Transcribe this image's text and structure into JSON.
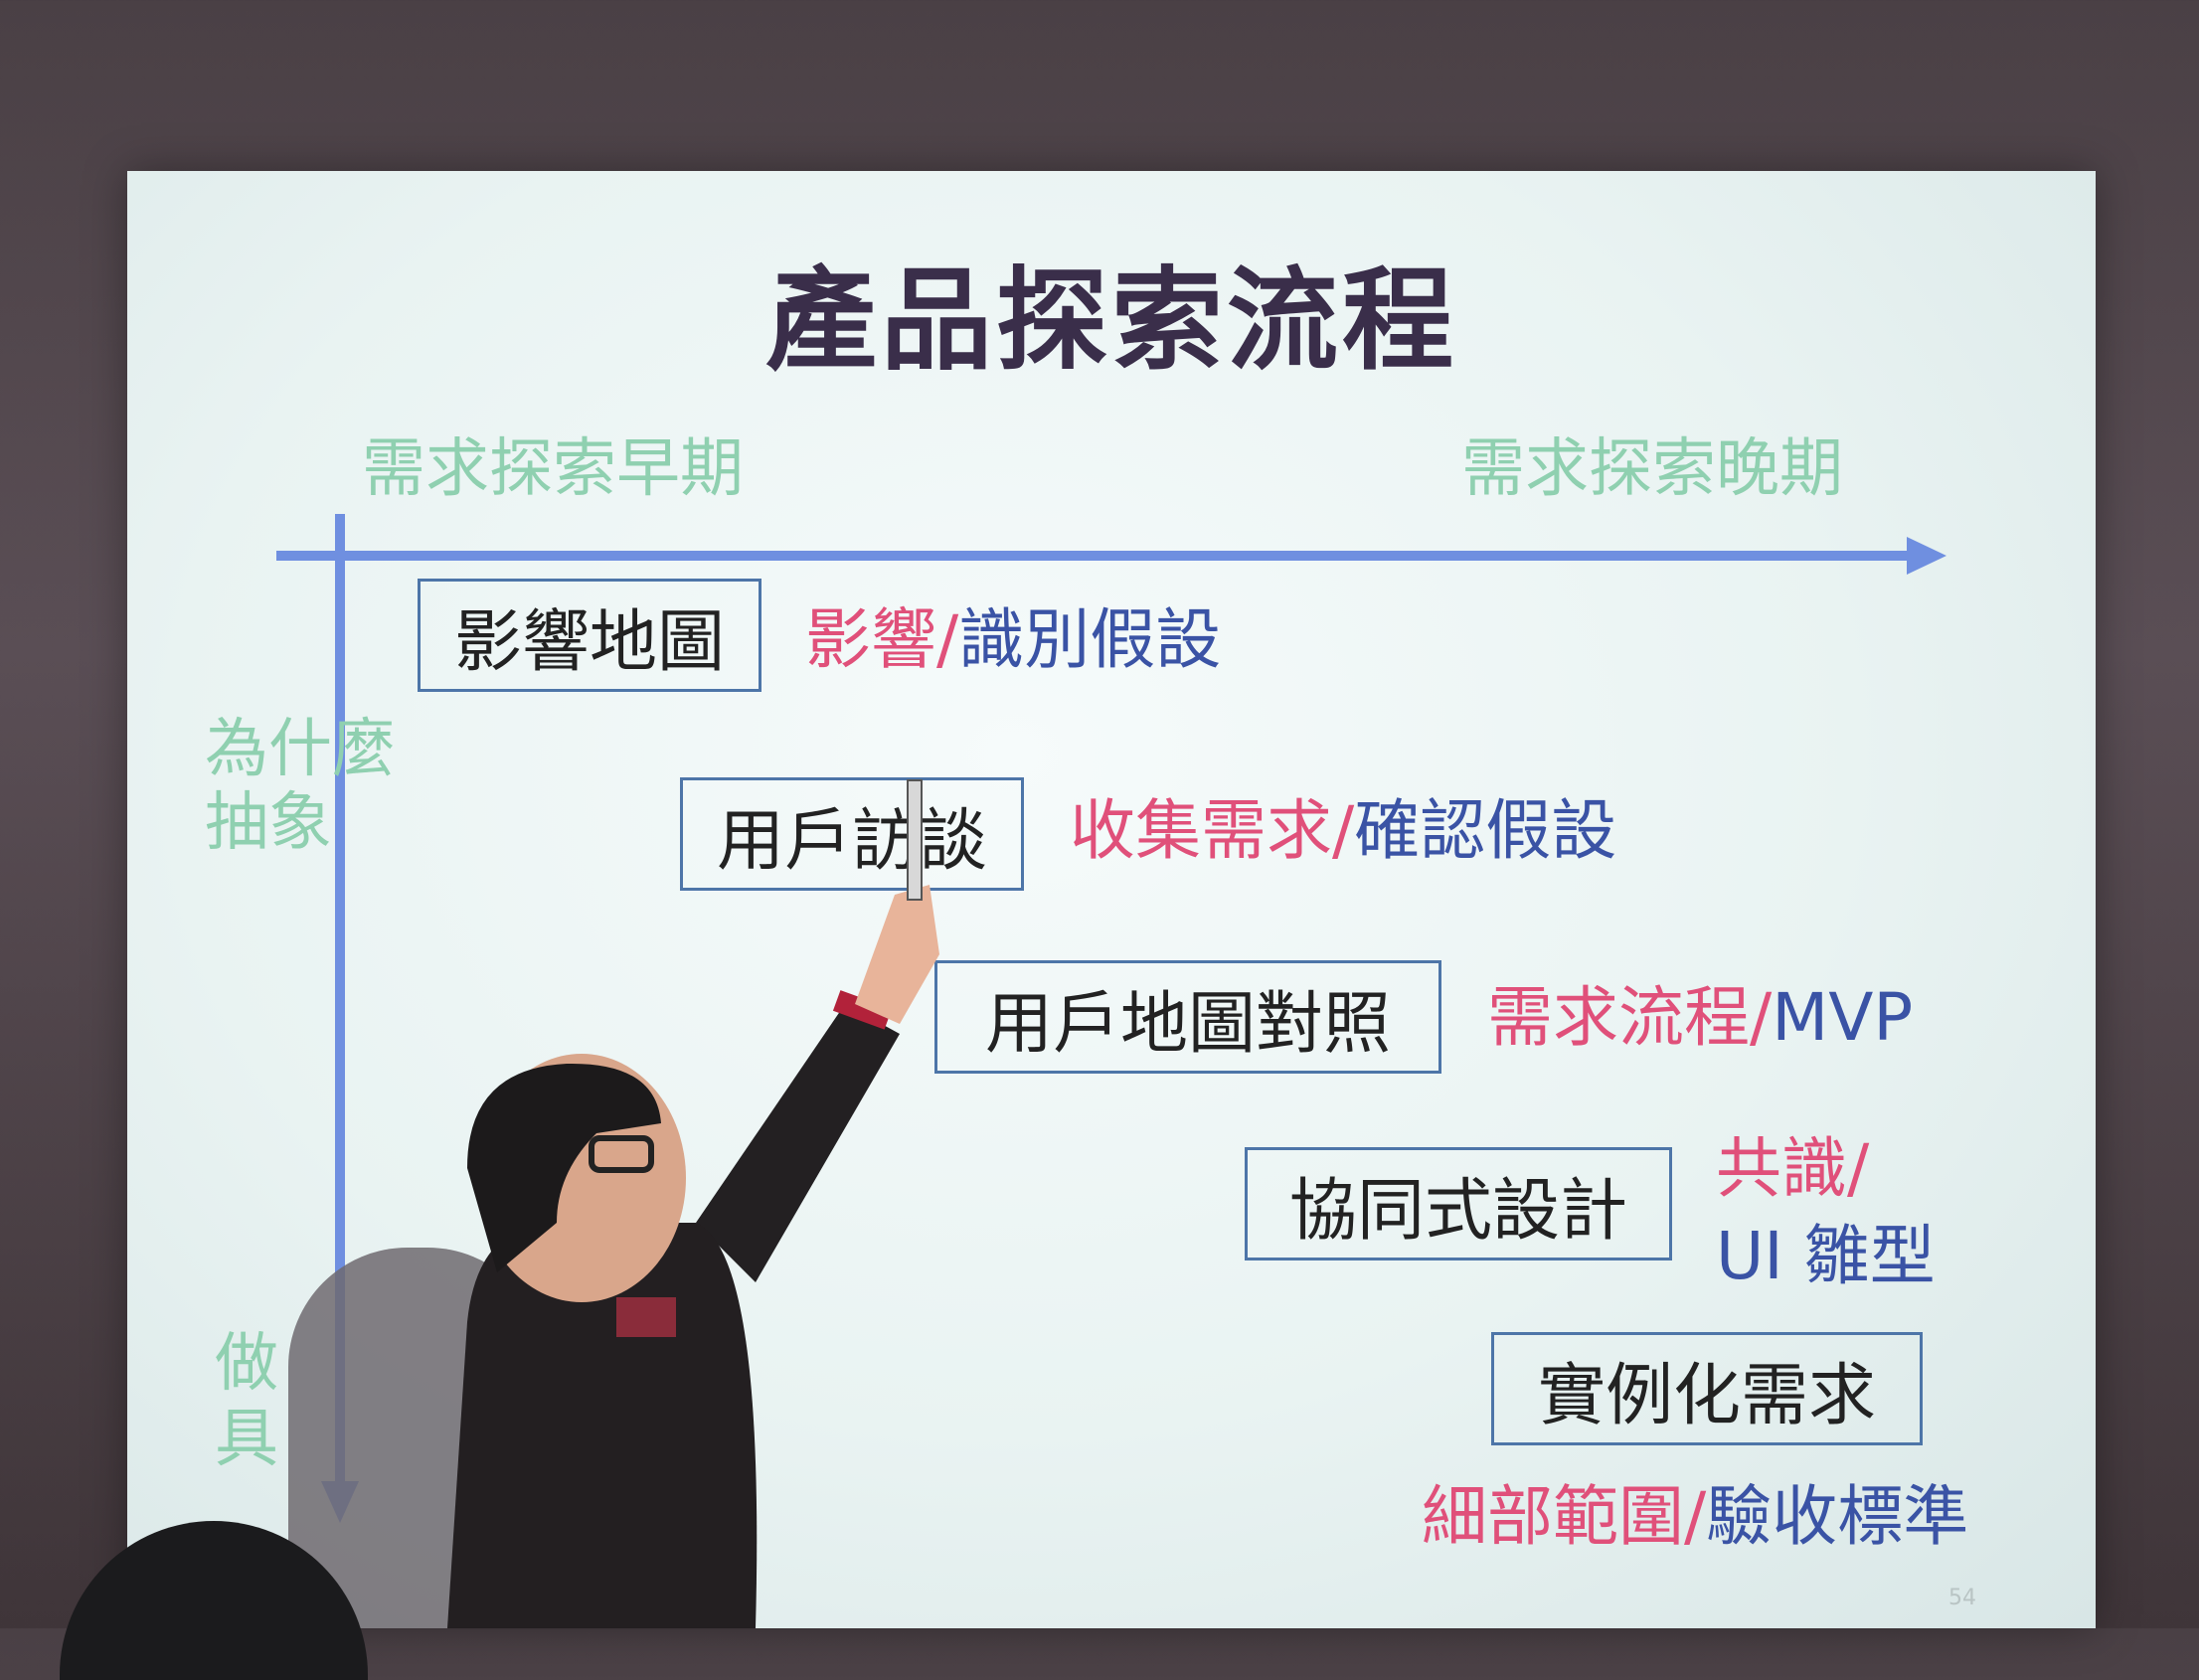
{
  "slide": {
    "title": "產品探索流程",
    "axis_top_left": "需求探索早期",
    "axis_top_right": "需求探索晚期",
    "axis_left_top_line1": "為什麼",
    "axis_left_top_line2": "抽象",
    "axis_left_bottom_line1": "做",
    "axis_left_bottom_line2": "具",
    "steps": [
      {
        "box": "影響地圖",
        "pink": "影響",
        "sep": "/",
        "blue": "識別假設"
      },
      {
        "box": "用戶訪談",
        "pink": "收集需求",
        "sep": "/",
        "blue": "確認假設"
      },
      {
        "box": "用戶地圖對照",
        "pink": "需求流程",
        "sep": "/",
        "blue": "MVP"
      },
      {
        "box": "協同式設計",
        "pink": "共識/",
        "blue": "UI 雛型"
      },
      {
        "box": "實例化需求",
        "pink": "細部範圍",
        "sep": "/",
        "blue": "驗收標準"
      }
    ],
    "page_number": "54"
  },
  "colors": {
    "title": "#3a2e4a",
    "axis_label": "#8fd0b0",
    "arrow": "#6f8fe0",
    "pink": "#e0507a",
    "blue": "#3a53a5",
    "box_border": "#4d75a8"
  }
}
